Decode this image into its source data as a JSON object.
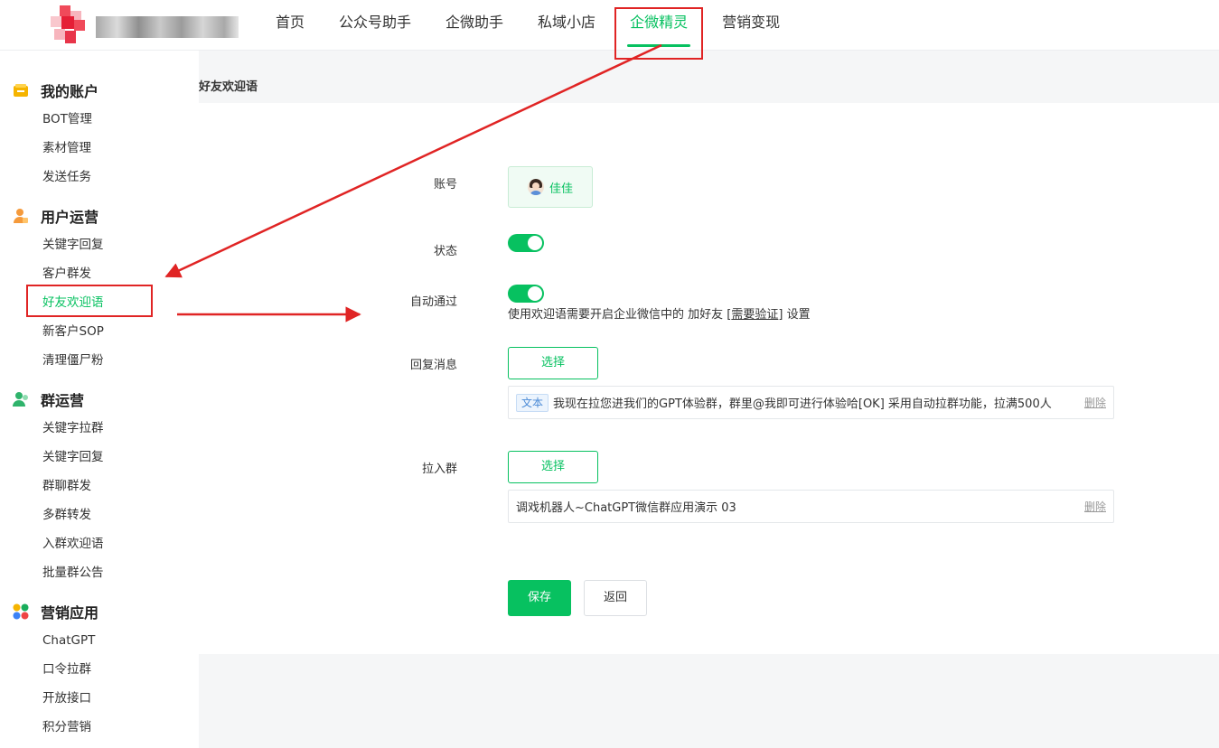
{
  "nav": {
    "items": [
      {
        "label": "首页"
      },
      {
        "label": "公众号助手"
      },
      {
        "label": "企微助手"
      },
      {
        "label": "私域小店"
      },
      {
        "label": "企微精灵"
      },
      {
        "label": "营销变现"
      }
    ],
    "active": "企微精灵"
  },
  "sidebar": {
    "groups": [
      {
        "title": "我的账户",
        "icon": "wallet-icon",
        "items": [
          "BOT管理",
          "素材管理",
          "发送任务"
        ]
      },
      {
        "title": "用户运营",
        "icon": "user-icon",
        "items": [
          "关键字回复",
          "客户群发",
          "好友欢迎语",
          "新客户SOP",
          "清理僵尸粉"
        ]
      },
      {
        "title": "群运营",
        "icon": "group-icon",
        "items": [
          "关键字拉群",
          "关键字回复",
          "群聊群发",
          "多群转发",
          "入群欢迎语",
          "批量群公告"
        ]
      },
      {
        "title": "营销应用",
        "icon": "apps-icon",
        "items": [
          "ChatGPT",
          "口令拉群",
          "开放接口",
          "积分营销"
        ]
      }
    ],
    "active": "好友欢迎语"
  },
  "page": {
    "breadcrumb": "好友欢迎语",
    "account_label": "账号",
    "account_name": "佳佳",
    "status_label": "状态",
    "auto_accept_label": "自动通过",
    "hint_prefix": "使用欢迎语需要开启企业微信中的 加好友 [",
    "hint_link": "需要验证",
    "hint_suffix": "] 设置",
    "reply_label": "回复消息",
    "select_label": "选择",
    "reply_tag": "文本",
    "reply_text": "我现在拉您进我们的GPT体验群，群里@我即可进行体验哈[OK] 采用自动拉群功能，拉满500人",
    "delete_label": "删除",
    "join_group_label": "拉入群",
    "group_name": "调戏机器人~ChatGPT微信群应用演示 03",
    "save_label": "保存",
    "back_label": "返回"
  },
  "colors": {
    "accent": "#07c160",
    "annotation": "#e02424"
  }
}
